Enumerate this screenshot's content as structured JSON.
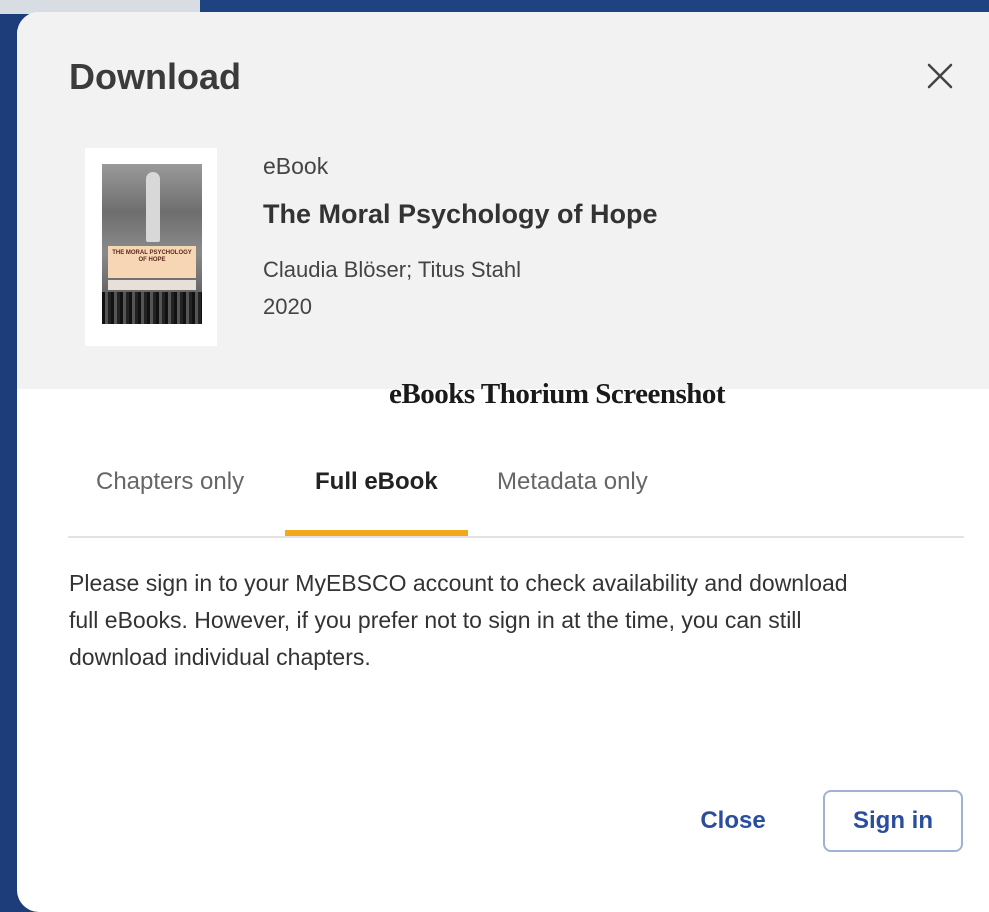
{
  "dialog": {
    "title": "Download",
    "close_icon": "close-icon"
  },
  "book": {
    "type": "eBook",
    "title": "The Moral Psychology of Hope",
    "authors": "Claudia Blöser; Titus Stahl",
    "year": "2020",
    "cover_title": "THE MORAL PSYCHOLOGY OF HOPE"
  },
  "caption": "eBooks Thorium Screenshot",
  "tabs": [
    {
      "label": "Chapters only",
      "active": false
    },
    {
      "label": "Full eBook",
      "active": true
    },
    {
      "label": "Metadata only",
      "active": false
    }
  ],
  "message": "Please sign in to your MyEBSCO account to check availability and download full eBooks. However, if you prefer not to sign in at the time, you can still download individual chapters.",
  "actions": {
    "close_label": "Close",
    "signin_label": "Sign in"
  },
  "colors": {
    "accent_tab": "#f2a81d",
    "button_text": "#2a4d9e",
    "backdrop": "#1c3d7a"
  }
}
